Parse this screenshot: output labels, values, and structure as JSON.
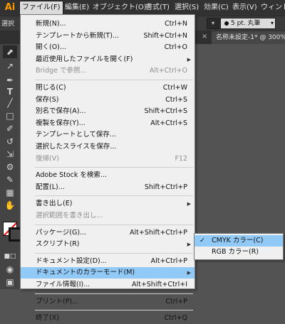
{
  "app": {
    "logo": "Ai"
  },
  "menubar": {
    "items": [
      {
        "label": "ファイル(F)",
        "active": true
      },
      {
        "label": "編集(E)"
      },
      {
        "label": "オブジェクト(O)"
      },
      {
        "label": "書式(T)"
      },
      {
        "label": "選択(S)"
      },
      {
        "label": "効果(C)"
      },
      {
        "label": "表示(V)"
      },
      {
        "label": "ウィンド"
      }
    ]
  },
  "controlbar": {
    "select_label": "選択",
    "brush_value": "5 pt. 丸筆"
  },
  "tabbar": {
    "doc_title": "名称未設定-1* @ 300% (CI"
  },
  "file_menu": {
    "groups": [
      [
        {
          "label": "新規(N)...",
          "shortcut": "Ctrl+N"
        },
        {
          "label": "テンプレートから新規(T)...",
          "shortcut": "Shift+Ctrl+N"
        },
        {
          "label": "開く(O)...",
          "shortcut": "Ctrl+O"
        },
        {
          "label": "最近使用したファイルを開く(F)",
          "shortcut": "",
          "submenu": true
        },
        {
          "label": "Bridge で参照...",
          "shortcut": "Alt+Ctrl+O",
          "disabled": true
        }
      ],
      [
        {
          "label": "閉じる(C)",
          "shortcut": "Ctrl+W"
        },
        {
          "label": "保存(S)",
          "shortcut": "Ctrl+S"
        },
        {
          "label": "別名で保存(A)...",
          "shortcut": "Shift+Ctrl+S"
        },
        {
          "label": "複製を保存(Y)...",
          "shortcut": "Alt+Ctrl+S"
        },
        {
          "label": "テンプレートとして保存...",
          "shortcut": ""
        },
        {
          "label": "選択したスライスを保存...",
          "shortcut": ""
        },
        {
          "label": "復帰(V)",
          "shortcut": "F12",
          "disabled": true
        }
      ],
      [
        {
          "label": "Adobe Stock を検索...",
          "shortcut": ""
        },
        {
          "label": "配置(L)...",
          "shortcut": "Shift+Ctrl+P"
        }
      ],
      [
        {
          "label": "書き出し(E)",
          "shortcut": "",
          "submenu": true
        },
        {
          "label": "選択範囲を書き出し...",
          "shortcut": "",
          "disabled": true
        }
      ],
      [
        {
          "label": "パッケージ(G)...",
          "shortcut": "Alt+Shift+Ctrl+P"
        },
        {
          "label": "スクリプト(R)",
          "shortcut": "",
          "submenu": true
        }
      ],
      [
        {
          "label": "ドキュメント設定(D)...",
          "shortcut": "Alt+Ctrl+P"
        },
        {
          "label": "ドキュメントのカラーモード(M)",
          "shortcut": "",
          "submenu": true,
          "highlight": true
        },
        {
          "label": "ファイル情報(I)...",
          "shortcut": "Alt+Shift+Ctrl+I"
        }
      ],
      [
        {
          "label": "プリント(P)...",
          "shortcut": "Ctrl+P"
        }
      ],
      [
        {
          "label": "終了(X)",
          "shortcut": "Ctrl+Q"
        }
      ]
    ]
  },
  "color_mode_submenu": {
    "items": [
      {
        "label": "CMYK カラー(C)",
        "checked": true,
        "highlight": true
      },
      {
        "label": "RGB カラー(R)",
        "checked": false
      }
    ]
  },
  "icons": {
    "check": "check-icon",
    "submenu_arrow": "chevron-right-icon",
    "close": "close-icon"
  }
}
